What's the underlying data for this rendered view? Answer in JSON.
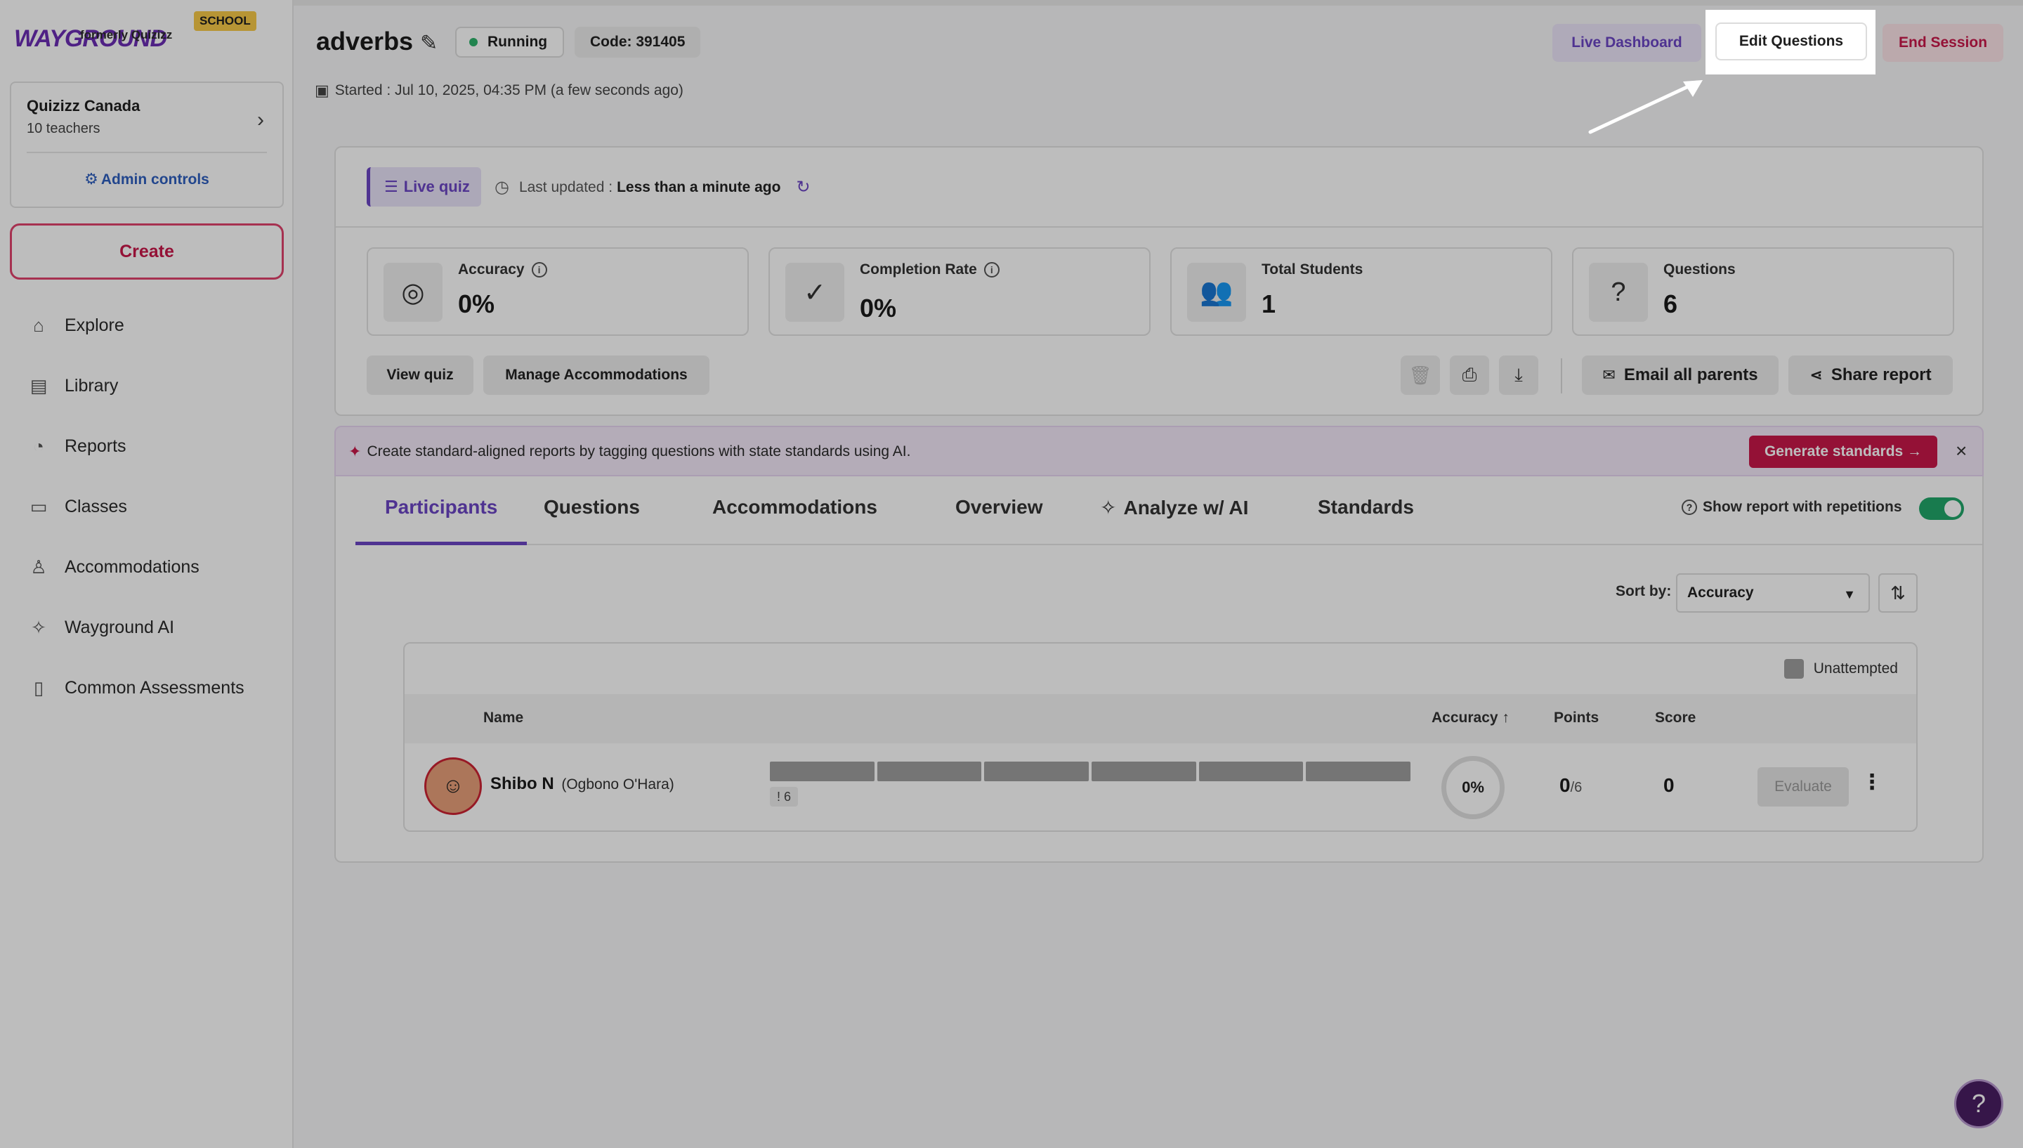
{
  "sidebar": {
    "logo": "WAYGROUND",
    "logo_sub": "formerly Quizizz",
    "school_badge": "SCHOOL",
    "org": {
      "name": "Quizizz Canada",
      "sub": "10 teachers",
      "admin": "Admin controls"
    },
    "create": "Create",
    "items": [
      {
        "label": "Explore",
        "icon": "home-icon"
      },
      {
        "label": "Library",
        "icon": "library-icon"
      },
      {
        "label": "Reports",
        "icon": "reports-icon"
      },
      {
        "label": "Classes",
        "icon": "classes-icon"
      },
      {
        "label": "Accommodations",
        "icon": "accommodations-icon"
      },
      {
        "label": "Wayground AI",
        "icon": "sparkle-icon"
      },
      {
        "label": "Common Assessments",
        "icon": "clipboard-icon"
      }
    ]
  },
  "header": {
    "title": "adverbs",
    "status": "Running",
    "code": "Code: 391405",
    "started": "Started : Jul 10, 2025, 04:35 PM (a few seconds ago)",
    "live_dashboard": "Live Dashboard",
    "edit_questions": "Edit Questions",
    "end_session": "End Session"
  },
  "report": {
    "live_quiz": "Live quiz",
    "last_updated_label": "Last updated :",
    "last_updated_value": "Less than a minute ago",
    "stats": [
      {
        "label": "Accuracy",
        "value": "0%"
      },
      {
        "label": "Completion Rate",
        "value": "0%"
      },
      {
        "label": "Total Students",
        "value": "1"
      },
      {
        "label": "Questions",
        "value": "6"
      }
    ],
    "view_quiz": "View quiz",
    "manage_accommodations": "Manage Accommodations",
    "email_parents": "Email all parents",
    "share_report": "Share report"
  },
  "banner": {
    "text": "Create standard-aligned reports by tagging questions with state standards using AI.",
    "button": "Generate standards →"
  },
  "tabs": [
    "Participants",
    "Questions",
    "Accommodations",
    "Overview",
    "Analyze w/ AI",
    "Standards"
  ],
  "repetitions_label": "Show report with repetitions",
  "sort": {
    "label": "Sort by:",
    "value": "Accuracy"
  },
  "table": {
    "legend": "Unattempted",
    "headers": {
      "name": "Name",
      "accuracy": "Accuracy",
      "points": "Points",
      "score": "Score"
    },
    "rows": [
      {
        "name": "Shibo N",
        "sub": "(Ogbono O'Hara)",
        "unattempted": "! 6",
        "accuracy": "0%",
        "points": "0",
        "points_den": "/6",
        "score": "0",
        "evaluate": "Evaluate"
      }
    ]
  },
  "colors": {
    "accent": "#6b45c4",
    "danger": "#c8174a",
    "success": "#21a76a"
  }
}
